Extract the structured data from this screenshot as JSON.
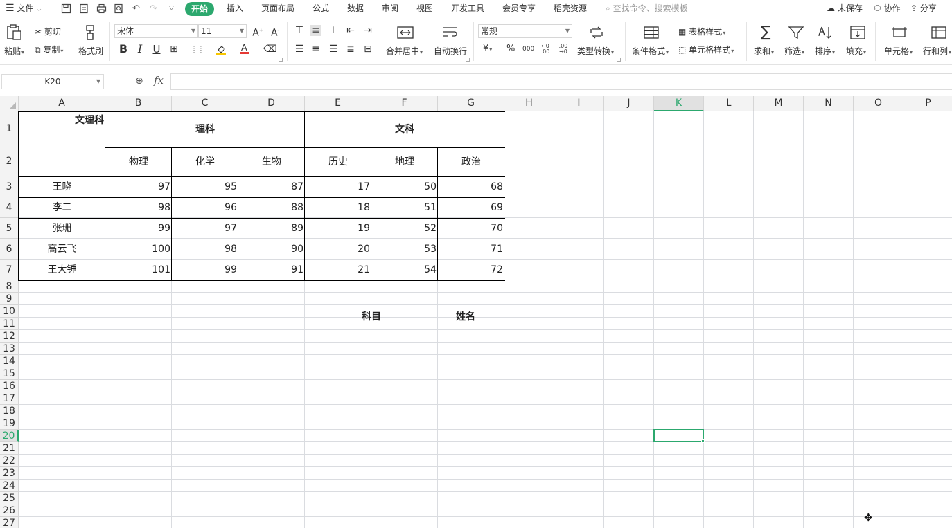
{
  "menubar": {
    "file_label": "文件",
    "tabs": [
      "开始",
      "插入",
      "页面布局",
      "公式",
      "数据",
      "审阅",
      "视图",
      "开发工具",
      "会员专享",
      "稻壳资源"
    ],
    "search_placeholder": "查找命令、搜索模板",
    "unsaved_label": "未保存",
    "collab_label": "协作",
    "share_label": "分享"
  },
  "ribbon": {
    "paste": "粘贴",
    "cut": "剪切",
    "copy": "复制",
    "format_painter": "格式刷",
    "font_name": "宋体",
    "font_size": "11",
    "merge_center": "合并居中",
    "wrap_text": "自动换行",
    "number_format": "常规",
    "type_convert": "类型转换",
    "cond_format": "条件格式",
    "table_style": "表格样式",
    "cell_style": "单元格样式",
    "sum": "求和",
    "filter": "筛选",
    "sort": "排序",
    "fill": "填充",
    "cell": "单元格",
    "row_col": "行和列",
    "currency_symbol": "¥",
    "percent_symbol": "%"
  },
  "formula_bar": {
    "name_box": "K20",
    "fx": "fx",
    "content": ""
  },
  "sheet": {
    "columns": [
      "A",
      "B",
      "C",
      "D",
      "E",
      "F",
      "G",
      "H",
      "I",
      "J",
      "K",
      "L",
      "M",
      "N",
      "O",
      "P"
    ],
    "selected_column": "K",
    "row_labels": [
      "1",
      "2",
      "3",
      "4",
      "5",
      "6",
      "7",
      "8",
      "9",
      "10",
      "11",
      "12",
      "13",
      "14",
      "15",
      "16",
      "17",
      "18",
      "19",
      "20",
      "21",
      "22",
      "23",
      "24",
      "25",
      "26",
      "27"
    ],
    "selected_row": "20",
    "header": {
      "corner": "文理科",
      "science": "理科",
      "arts": "文科",
      "subjects": [
        "物理",
        "化学",
        "生物",
        "历史",
        "地理",
        "政治"
      ]
    },
    "students": [
      {
        "name": "王晓",
        "scores": [
          97,
          95,
          87,
          17,
          50,
          68
        ]
      },
      {
        "name": "李二",
        "scores": [
          98,
          96,
          88,
          18,
          51,
          69
        ]
      },
      {
        "name": "张珊",
        "scores": [
          99,
          97,
          89,
          19,
          52,
          70
        ]
      },
      {
        "name": "高云飞",
        "scores": [
          100,
          98,
          90,
          20,
          53,
          71
        ]
      },
      {
        "name": "王大锤",
        "scores": [
          101,
          99,
          91,
          21,
          54,
          72
        ]
      }
    ],
    "extra_labels": {
      "subject": "科目",
      "name": "姓名"
    }
  }
}
